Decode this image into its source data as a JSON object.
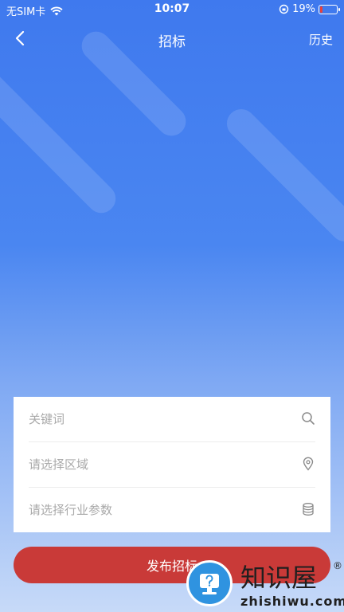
{
  "status_bar": {
    "carrier": "无SIM卡",
    "time": "10:07",
    "battery_percent": "19%",
    "battery_level": 0.19
  },
  "navbar": {
    "title": "招标",
    "right_label": "历史"
  },
  "form": {
    "keyword_placeholder": "关键词",
    "region_placeholder": "请选择区域",
    "industry_placeholder": "请选择行业参数"
  },
  "submit_label": "发布招标",
  "watermark": {
    "text": "知识屋",
    "sub": "zhishiwu.com",
    "reg": "®"
  },
  "colors": {
    "submit_bg": "#c93a38",
    "header_blue": "#3f79ee"
  }
}
